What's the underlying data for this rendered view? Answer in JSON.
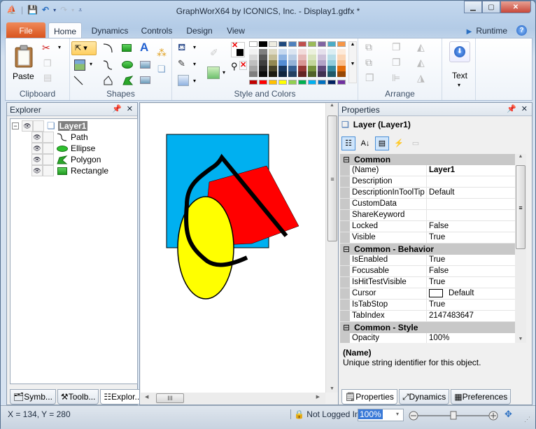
{
  "window": {
    "title": "GraphWorX64 by ICONICS, Inc. - Display1.gdfx *",
    "buttons": [
      "minimize",
      "maximize",
      "close"
    ]
  },
  "quick_access": [
    "app-icon",
    "save-icon",
    "undo-icon",
    "redo-icon",
    "customize-icon"
  ],
  "ribbon": {
    "tabs": [
      {
        "label": "File"
      },
      {
        "label": "Home",
        "active": true
      },
      {
        "label": "Dynamics"
      },
      {
        "label": "Controls"
      },
      {
        "label": "Design"
      },
      {
        "label": "View"
      }
    ],
    "runtime_label": "Runtime",
    "groups": {
      "clipboard": {
        "label": "Clipboard",
        "paste_label": "Paste"
      },
      "shapes": {
        "label": "Shapes"
      },
      "style": {
        "label": "Style and Colors"
      },
      "arrange": {
        "label": "Arrange"
      },
      "text": {
        "label": "Text"
      }
    },
    "palette": {
      "top_row": [
        "#ffffff",
        "#000000",
        "#eeece1",
        "#1f497d",
        "#4f81bd",
        "#c0504d",
        "#9bbb59",
        "#8064a2",
        "#4bacc6",
        "#f79646"
      ],
      "shade_columns": [
        [
          "#f2f2f2",
          "#d8d8d8",
          "#bfbfbf",
          "#a5a5a5",
          "#7f7f7f"
        ],
        [
          "#7f7f7f",
          "#595959",
          "#3f3f3f",
          "#262626",
          "#0c0c0c"
        ],
        [
          "#ddd9c3",
          "#c4bd97",
          "#938953",
          "#494429",
          "#1d1b10"
        ],
        [
          "#c6d9f0",
          "#8db3e2",
          "#548dd4",
          "#17365d",
          "#0f243e"
        ],
        [
          "#dbe5f1",
          "#b8cce4",
          "#95b3d7",
          "#366092",
          "#244061"
        ],
        [
          "#f2dcdb",
          "#e5b9b7",
          "#d99694",
          "#953734",
          "#632423"
        ],
        [
          "#ebf1dd",
          "#d7e3bc",
          "#c3d69b",
          "#76923c",
          "#4f6128"
        ],
        [
          "#e5e0ec",
          "#ccc1d9",
          "#b2a2c7",
          "#5f497a",
          "#3f3151"
        ],
        [
          "#dbeef3",
          "#b7dde8",
          "#92cddc",
          "#31859b",
          "#205867"
        ],
        [
          "#fdeada",
          "#fbd5b5",
          "#fac08f",
          "#e36c09",
          "#974806"
        ]
      ],
      "standard_row": [
        "#c00000",
        "#ff0000",
        "#ffc000",
        "#ffff00",
        "#92d050",
        "#00b050",
        "#00b0f0",
        "#0070c0",
        "#002060",
        "#7030a0"
      ]
    }
  },
  "explorer": {
    "title": "Explorer",
    "layer": "Layer1",
    "children": [
      {
        "label": "Path",
        "icon": "path-icon"
      },
      {
        "label": "Ellipse",
        "icon": "ellipse-icon"
      },
      {
        "label": "Polygon",
        "icon": "polygon-icon"
      },
      {
        "label": "Rectangle",
        "icon": "rectangle-icon"
      }
    ],
    "bottom_tabs": [
      {
        "label": "Symb..."
      },
      {
        "label": "Toolb..."
      },
      {
        "label": "Explor...",
        "active": true
      }
    ]
  },
  "canvas": {
    "shapes": [
      {
        "type": "rectangle",
        "fill": "#00b0f0"
      },
      {
        "type": "polygon",
        "fill": "#ff0000"
      },
      {
        "type": "ellipse",
        "fill": "#ffff00"
      },
      {
        "type": "path",
        "stroke": "#000000"
      }
    ]
  },
  "properties": {
    "title": "Properties",
    "object": "Layer (Layer1)",
    "categories": [
      {
        "name": "Common",
        "rows": [
          {
            "key": "(Name)",
            "value": "Layer1",
            "bold": true
          },
          {
            "key": "Description",
            "value": ""
          },
          {
            "key": "DescriptionInToolTip",
            "value": "Default"
          },
          {
            "key": "CustomData",
            "value": ""
          },
          {
            "key": "ShareKeyword",
            "value": ""
          },
          {
            "key": "Locked",
            "value": "False"
          },
          {
            "key": "Visible",
            "value": "True"
          }
        ]
      },
      {
        "name": "Common - Behavior",
        "rows": [
          {
            "key": "IsEnabled",
            "value": "True"
          },
          {
            "key": "Focusable",
            "value": "False"
          },
          {
            "key": "IsHitTestVisible",
            "value": "True"
          },
          {
            "key": "Cursor",
            "value": "Default",
            "swatch": true
          },
          {
            "key": "IsTabStop",
            "value": "True"
          },
          {
            "key": "TabIndex",
            "value": "2147483647"
          }
        ]
      },
      {
        "name": "Common - Style",
        "rows": [
          {
            "key": "Opacity",
            "value": "100%"
          }
        ]
      }
    ],
    "description_title": "(Name)",
    "description_text": "Unique string identifier for this object.",
    "bottom_tabs": [
      {
        "label": "Properties",
        "active": true
      },
      {
        "label": "Dynamics"
      },
      {
        "label": "Preferences"
      }
    ]
  },
  "status": {
    "coords": "X = 134, Y = 280",
    "login": "Not Logged In",
    "zoom": "100%",
    "zoom_slider_fraction": 0.5
  }
}
